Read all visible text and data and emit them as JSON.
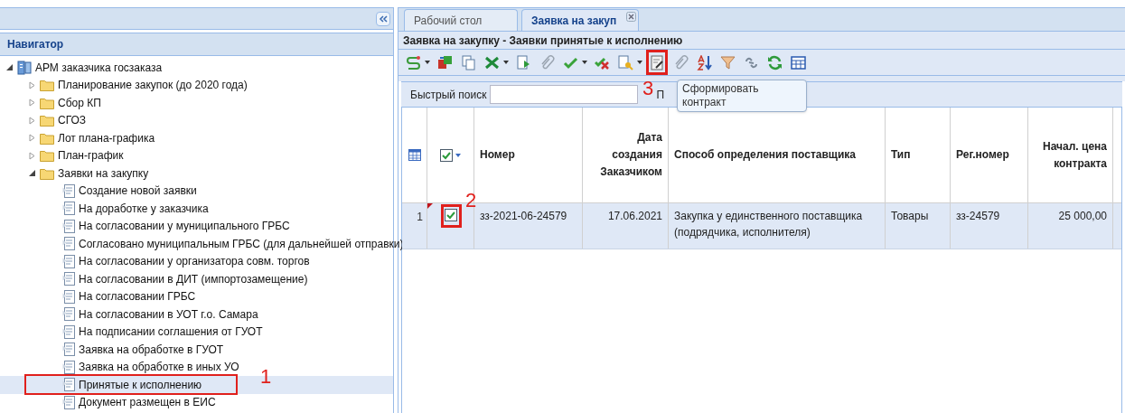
{
  "navigator": {
    "title": "Навигатор",
    "tree": [
      {
        "label": "АРМ заказчика госзаказа",
        "kind": "root",
        "expanded": true,
        "selected": false,
        "children": [
          {
            "label": "Планирование закупок (до 2020 года)",
            "kind": "folder",
            "expanded": false,
            "selected": false
          },
          {
            "label": "Сбор КП",
            "kind": "folder",
            "expanded": false,
            "selected": false
          },
          {
            "label": "СГОЗ",
            "kind": "folder",
            "expanded": false,
            "selected": false
          },
          {
            "label": "Лот плана-графика",
            "kind": "folder",
            "expanded": false,
            "selected": false
          },
          {
            "label": "План-график",
            "kind": "folder",
            "expanded": false,
            "selected": false
          },
          {
            "label": "Заявки на закупку",
            "kind": "folder",
            "expanded": true,
            "selected": false,
            "children": [
              {
                "label": "Создание новой заявки",
                "kind": "doc",
                "selected": false
              },
              {
                "label": "На доработке у заказчика",
                "kind": "doc",
                "selected": false
              },
              {
                "label": "На согласовании у муниципального ГРБС",
                "kind": "doc",
                "selected": false
              },
              {
                "label": "Согласовано муниципальным ГРБС (для дальнейшей отправки)",
                "kind": "doc",
                "selected": false
              },
              {
                "label": "На согласовании у организатора совм. торгов",
                "kind": "doc",
                "selected": false
              },
              {
                "label": "На согласовании в ДИТ (импортозамещение)",
                "kind": "doc",
                "selected": false
              },
              {
                "label": "На согласовании ГРБС",
                "kind": "doc",
                "selected": false
              },
              {
                "label": "На согласовании в УОТ г.о. Самара",
                "kind": "doc",
                "selected": false
              },
              {
                "label": "На подписании соглашения от ГУОТ",
                "kind": "doc",
                "selected": false
              },
              {
                "label": "Заявка на обработке в ГУОТ",
                "kind": "doc",
                "selected": false
              },
              {
                "label": "Заявка на обработке в иных УО",
                "kind": "doc",
                "selected": false
              },
              {
                "label": "Принятые к исполнению",
                "kind": "doc",
                "selected": true,
                "callout": "1"
              },
              {
                "label": "Документ размещен в ЕИС",
                "kind": "doc",
                "selected": false
              }
            ]
          }
        ]
      }
    ]
  },
  "tabs": [
    {
      "label": "Рабочий стол",
      "selected": false
    },
    {
      "label": "Заявка на закуп",
      "selected": true,
      "closable": true
    }
  ],
  "panel_title": "Заявка на закупку - Заявки принятые к исполнению",
  "toolbar": [
    {
      "kind": "route",
      "dropdown": true
    },
    {
      "kind": "move",
      "dropdown": false
    },
    {
      "kind": "copy",
      "dropdown": false
    },
    {
      "kind": "excel",
      "dropdown": true
    },
    {
      "kind": "export",
      "dropdown": false
    },
    {
      "kind": "attach",
      "dropdown": false
    },
    {
      "kind": "approve",
      "dropdown": true
    },
    {
      "kind": "reject",
      "dropdown": false
    },
    {
      "kind": "key",
      "dropdown": true
    },
    {
      "kind": "contract",
      "dropdown": false,
      "callout": "3",
      "tooltip": "Сформировать контракт"
    },
    {
      "kind": "attach",
      "dropdown": false
    },
    {
      "kind": "sort",
      "dropdown": false
    },
    {
      "kind": "filter",
      "dropdown": false
    },
    {
      "kind": "link",
      "dropdown": false
    },
    {
      "kind": "refresh",
      "dropdown": false
    },
    {
      "kind": "table",
      "dropdown": false
    }
  ],
  "search": {
    "label": "Быстрый поиск",
    "next_label": "П"
  },
  "table": {
    "select_all_checked": true,
    "columns": [
      {
        "label": "Номер"
      },
      {
        "label": "Дата создания Заказчиком"
      },
      {
        "label": "Способ определения поставщика"
      },
      {
        "label": "Тип"
      },
      {
        "label": "Рег.номер"
      },
      {
        "label": "Начал. цена контракта"
      }
    ],
    "rows": [
      {
        "index": "1",
        "checked": true,
        "selected": true,
        "modified": true,
        "callout": "2",
        "cells": [
          "зз-2021-06-24579",
          "17.06.2021",
          "Закупка у единственного поставщика (подрядчика, исполнителя)",
          "Товары",
          "зз-24579",
          "25 000,00"
        ]
      }
    ]
  }
}
